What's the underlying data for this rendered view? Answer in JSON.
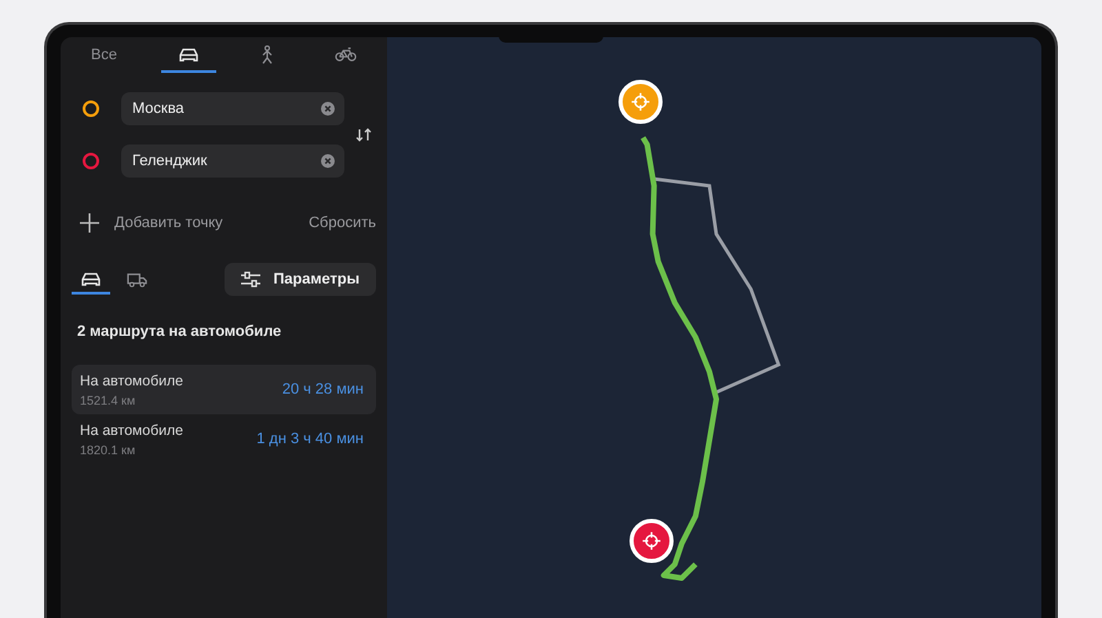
{
  "mode_tabs": [
    {
      "kind": "text",
      "label": "Все",
      "selected": false
    },
    {
      "kind": "car",
      "selected": true
    },
    {
      "kind": "walk",
      "selected": false
    },
    {
      "kind": "bike",
      "selected": false
    }
  ],
  "waypoints": [
    {
      "color": "#f59e0b",
      "value": "Москва"
    },
    {
      "color": "#e5173f",
      "value": "Геленджик"
    }
  ],
  "add_point": {
    "label": "Добавить точку"
  },
  "reset": {
    "label": "Сбросить"
  },
  "vehicle_tabs": [
    {
      "kind": "car",
      "selected": true
    },
    {
      "kind": "truck",
      "selected": false
    }
  ],
  "params_button": {
    "label": "Параметры"
  },
  "routes_heading": "2 маршрута на автомобиле",
  "routes": [
    {
      "title": "На автомобиле",
      "distance": "1521.4 км",
      "duration": "20 ч 28 мин",
      "selected": true
    },
    {
      "title": "На автомобиле",
      "distance": "1820.1 км",
      "duration": "1 дн 3 ч 40 мин",
      "selected": false
    }
  ]
}
